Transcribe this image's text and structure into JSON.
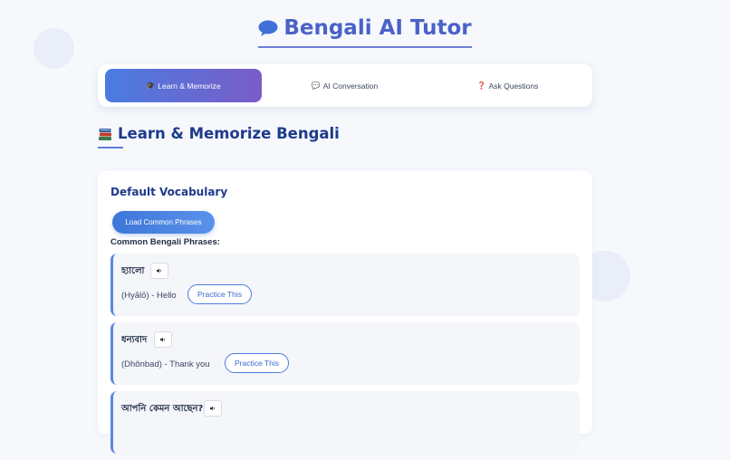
{
  "app": {
    "title": "Bengali AI Tutor"
  },
  "tabs": [
    {
      "icon": "🎓",
      "label": "Learn & Memorize"
    },
    {
      "icon": "💬",
      "label": "AI Conversation"
    },
    {
      "icon": "❓",
      "label": "Ask Questions"
    }
  ],
  "section": {
    "icon": "books-icon",
    "title": "Learn & Memorize Bengali"
  },
  "vocab": {
    "title": "Default Vocabulary",
    "load_button": "Load Common Phrases",
    "phrases_label": "Common Bengali Phrases:",
    "speak_icon": "🔈",
    "practice_label": "Practice This",
    "phrases": [
      {
        "bengali": "হ্যালো",
        "meaning": "(Hyālō) - Hello"
      },
      {
        "bengali": "ধন্যবাদ",
        "meaning": "(Dhônbad) - Thank you"
      },
      {
        "bengali": "আপনি কেমন আছেন?",
        "meaning": ""
      }
    ]
  },
  "colors": {
    "accent": "#4a7ce0",
    "heading": "#1e3a8a",
    "tab_active_end": "#7a5cc8"
  }
}
